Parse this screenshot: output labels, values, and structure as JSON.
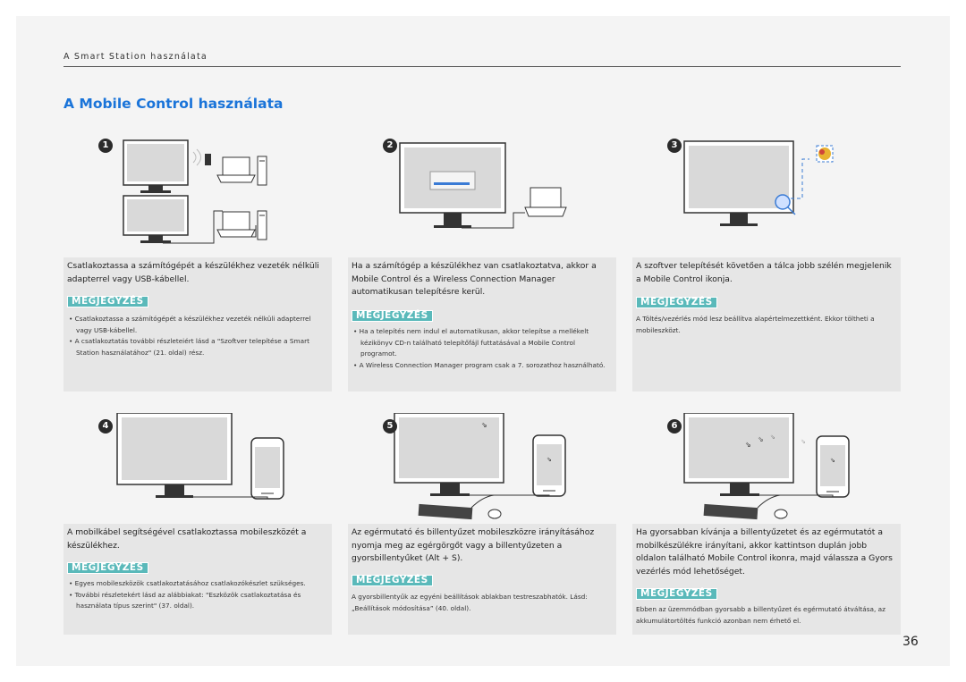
{
  "header": {
    "section": "A Smart Station használata"
  },
  "title": "A Mobile Control használata",
  "page_number": "36",
  "note_label": "MEGJEGYZÉS",
  "steps": [
    {
      "num": "1",
      "desc": [
        "Csatlakoztassa a számítógépét a készülékhez vezeték nélküli adapterrel vagy USB-kábellel."
      ],
      "notes": [
        "Csatlakoztassa a számítógépét a készülékhez vezeték nélküli adapterrel vagy USB-kábellel.",
        "A csatlakoztatás további részleteiért lásd a \"Szoftver telepítése a Smart Station használatához\" (21. oldal) rész."
      ]
    },
    {
      "num": "2",
      "desc": [
        "Ha a számítógép a készülékhez van csatlakoztatva, akkor a Mobile Control és a Wireless Connection Manager automatikusan telepítésre kerül."
      ],
      "notes": [
        "Ha a telepítés nem indul el automatikusan, akkor telepítse a mellékelt kézikönyv CD-n található telepítőfájl futtatásával a Mobile Control programot.",
        "A Wireless Connection Manager program csak a 7. sorozathoz használható."
      ]
    },
    {
      "num": "3",
      "desc": [
        "A szoftver telepítését követően a tálca jobb szélén megjelenik a Mobile Control ikonja."
      ],
      "notes": [
        "A Töltés/vezérlés mód lesz beállítva alapértelmezettként. Ekkor töltheti a mobileszközt."
      ]
    },
    {
      "num": "4",
      "desc": [
        "A mobilkábel segítségével csatlakoztassa mobileszközét a készülékhez."
      ],
      "notes": [
        "Egyes mobileszközök csatlakoztatásához csatlakozókészlet szükséges.",
        "További részletekért lásd az alábbiakat: \"Eszközök csatlakoztatása és használata típus szerint\" (37. oldal)."
      ]
    },
    {
      "num": "5",
      "desc": [
        "Az egérmutató és billentyűzet mobileszközre irányításához nyomja meg az egérgörgőt vagy a billentyűzeten a gyorsbillentyűket (Alt + S)."
      ],
      "notes": [
        "A gyorsbillentyűk az egyéni beállítások ablakban testreszabhatók. Lásd: „Beállítások módosítása” (40. oldal)."
      ]
    },
    {
      "num": "6",
      "desc": [
        "Ha gyorsabban kívánja a billentyűzetet és az egérmutatót a mobilkészülékre irányítani, akkor kattintson duplán jobb oldalon található Mobile Control ikonra, majd válassza a Gyors vezérlés mód lehetőséget."
      ],
      "notes": [
        "Ebben az üzemmódban gyorsabb a billentyűzet és egérmutató átváltása, az akkumulátortöltés funkció azonban nem érhető el."
      ]
    }
  ]
}
